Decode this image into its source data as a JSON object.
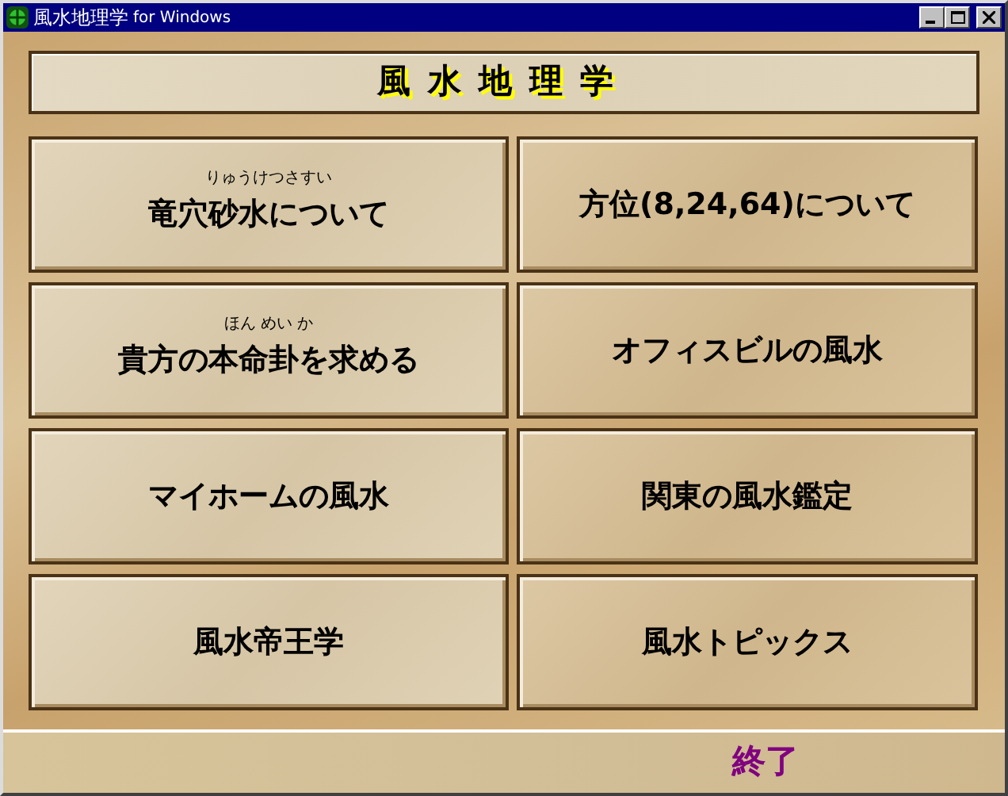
{
  "window": {
    "title": "風水地理学",
    "title_suffix": "for Windows"
  },
  "header": {
    "text": "風水地理学"
  },
  "menu": [
    {
      "label": "竜穴砂水について",
      "ruby": "りゅうけつさすい"
    },
    {
      "label": "方位(8,24,64)について"
    },
    {
      "label": "貴方の本命卦を求める",
      "ruby": "ほん めい か"
    },
    {
      "label": "オフィスビルの風水"
    },
    {
      "label": "マイホームの風水"
    },
    {
      "label": "関東の風水鑑定"
    },
    {
      "label": "風水帝王学"
    },
    {
      "label": "風水トピックス"
    }
  ],
  "exit_button": "終了"
}
